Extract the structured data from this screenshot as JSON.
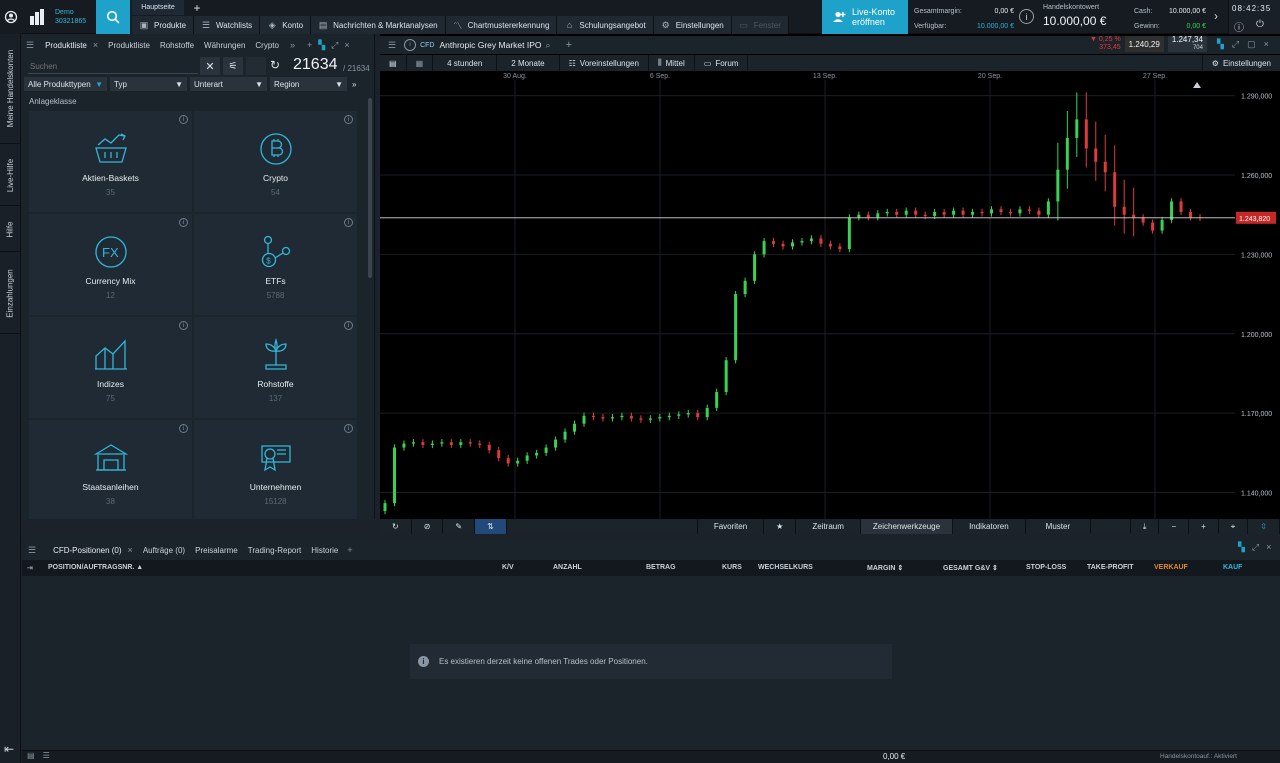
{
  "topbar": {
    "account_type": "Demo",
    "account_number": "30321865",
    "hauptseite_tab": "Hauptseite",
    "nav": [
      {
        "icon": "box-icon",
        "label": "Produkte"
      },
      {
        "icon": "list-icon",
        "label": "Watchlists"
      },
      {
        "icon": "tag-icon",
        "label": "Konto"
      },
      {
        "icon": "newspaper-icon",
        "label": "Nachrichten & Marktanalysen"
      },
      {
        "icon": "chart-pattern-icon",
        "label": "Chartmustererkennung"
      },
      {
        "icon": "graduation-cap-icon",
        "label": "Schulungsangebot"
      },
      {
        "icon": "gear-icon",
        "label": "Einstellungen"
      },
      {
        "icon": "window-icon",
        "label": "Fenster"
      }
    ],
    "live_button": {
      "line1": "Live-Konto",
      "line2": "eröffnen"
    },
    "gesamtmargin_label": "Gesamtmargin:",
    "gesamtmargin_value": "0,00 €",
    "verfuegbar_label": "Verfügbar:",
    "verfuegbar_value": "10.000,00 €",
    "handelskontowert_label": "Handelskontowert",
    "handelskontowert_value": "10.000,00 €",
    "cash_label": "Cash:",
    "cash_value": "10.000,00 €",
    "gewinn_label": "Gewinn:",
    "gewinn_value": "0,00 €",
    "clock": "08:42:35"
  },
  "sidebar": {
    "tabs": [
      "Meine Handelskonten",
      "Live-Hilfe",
      "Hilfe",
      "Einzahlungen"
    ]
  },
  "product_panel": {
    "tabs": [
      {
        "label": "Produktliste",
        "active": true
      },
      {
        "label": "Produktliste"
      },
      {
        "label": "Rohstoffe"
      },
      {
        "label": "Währungen"
      },
      {
        "label": "Crypto"
      }
    ],
    "search_placeholder": "Suchen",
    "count": "21634",
    "count_total": "/ 21634",
    "filters": [
      "Alle Produkttypen",
      "Typ",
      "Unterart",
      "Region"
    ],
    "section_label": "Anlageklasse",
    "categories": [
      {
        "name": "Aktien-Baskets",
        "count": "35",
        "icon": "basket-chart-icon"
      },
      {
        "name": "Crypto",
        "count": "54",
        "icon": "bitcoin-icon"
      },
      {
        "name": "Currency Mix",
        "count": "12",
        "icon": "fx-icon"
      },
      {
        "name": "ETFs",
        "count": "5788",
        "icon": "etf-network-icon"
      },
      {
        "name": "Indizes",
        "count": "75",
        "icon": "index-chart-icon"
      },
      {
        "name": "Rohstoffe",
        "count": "137",
        "icon": "plant-icon"
      },
      {
        "name": "Staatsanleihen",
        "count": "38",
        "icon": "government-building-icon"
      },
      {
        "name": "Unternehmen",
        "count": "15128",
        "icon": "certificate-icon"
      }
    ]
  },
  "chart_panel": {
    "badge": "CFD",
    "instrument": "Anthropic Grey Market IPO",
    "change_pct": "▼ 0,25 %",
    "change_abs": "373,45",
    "bid": "1.240,29",
    "ask": "1.247,34",
    "spread": "704",
    "toolbar": [
      "4 stunden",
      "2 Monate",
      "Voreinstellungen",
      "Mittel",
      "Forum"
    ],
    "settings_label": "Einstellungen",
    "bottom_tools": [
      "Favoriten",
      "Zeitraum",
      "Zeichenwerkzeuge",
      "Indikatoren",
      "Muster"
    ],
    "accent_up": "#39d353",
    "accent_down": "#e03b3b"
  },
  "chart_data": {
    "type": "candlestick",
    "x_labels": [
      "30 Aug.",
      "6 Sep.",
      "13 Sep.",
      "20 Sep.",
      "27 Sep."
    ],
    "y_ticks": [
      1140000,
      1170000,
      1200000,
      1230000,
      1260000,
      1290000
    ],
    "y_tick_labels": [
      "1.140,000",
      "1.170,000",
      "1.200,000",
      "1.230,000",
      "1.260,000",
      "1.290,000"
    ],
    "ylim": [
      1130000,
      1294000
    ],
    "current_price_label": "1.243,820",
    "current_price": 1243820,
    "closes": [
      1136000,
      1157000,
      1158500,
      1159000,
      1158000,
      1158500,
      1159000,
      1158000,
      1159000,
      1158500,
      1158000,
      1156000,
      1153000,
      1151000,
      1152000,
      1154000,
      1155000,
      1157000,
      1160000,
      1163000,
      1166000,
      1169000,
      1168500,
      1168000,
      1168500,
      1169000,
      1168000,
      1167500,
      1168000,
      1168500,
      1169000,
      1169500,
      1170000,
      1168500,
      1172000,
      1178000,
      1190000,
      1215000,
      1220000,
      1230000,
      1235000,
      1234000,
      1233000,
      1234500,
      1235000,
      1236000,
      1234000,
      1233000,
      1232000,
      1244000,
      1245000,
      1244000,
      1245500,
      1246000,
      1245000,
      1246500,
      1245000,
      1244500,
      1246000,
      1245000,
      1246500,
      1245000,
      1246000,
      1245500,
      1247000,
      1246000,
      1245500,
      1247000,
      1246500,
      1245000,
      1250000,
      1262000,
      1274000,
      1281000,
      1270000,
      1265000,
      1261000,
      1248000,
      1245000,
      1244000,
      1242000,
      1239000,
      1243000,
      1250000,
      1246000,
      1244000,
      1243820
    ]
  },
  "lower_panel": {
    "tabs": [
      "CFD-Positionen (0)",
      "Aufträge (0)",
      "Preisalarme",
      "Trading-Report",
      "Historie"
    ],
    "columns": [
      "POSITION/AUFTRAGSNR.",
      "K/V",
      "ANZAHL",
      "BETRAG",
      "KURS",
      "WECHSELKURS",
      "MARGIN",
      "GESAMT G&V",
      "STOP-LOSS",
      "TAKE-PROFIT",
      "VERKAUF",
      "KAUF"
    ],
    "empty_message": "Es existieren derzeit keine offenen Trades oder Positionen."
  },
  "statusbar": {
    "value": "0,00 €",
    "status": "Handelskontoauf.: Aktiviert"
  }
}
